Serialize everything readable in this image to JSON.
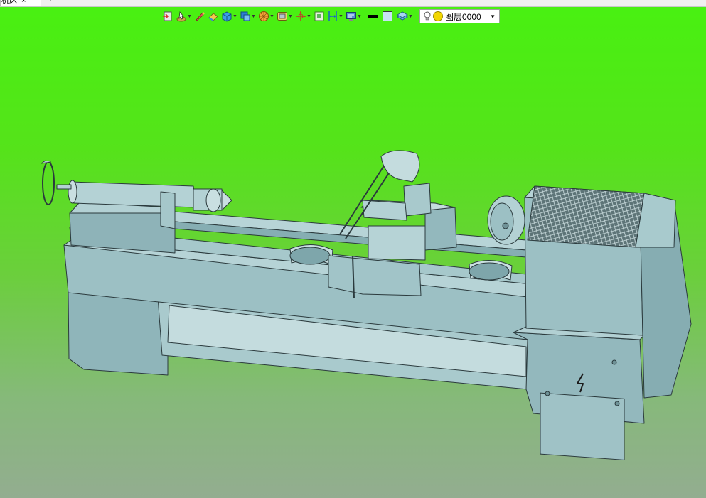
{
  "tab": {
    "title": "机床",
    "close": "×",
    "add": "+"
  },
  "toolbar": {
    "items": [
      {
        "name": "exit-sketch-icon"
      },
      {
        "name": "pointer-tool-icon"
      },
      {
        "name": "pen-tool-icon"
      },
      {
        "name": "eraser-tool-icon"
      },
      {
        "name": "solid-box-icon"
      },
      {
        "name": "view-orientation-icon"
      },
      {
        "name": "render-style-icon"
      },
      {
        "name": "section-view-icon"
      },
      {
        "name": "origin-icon"
      },
      {
        "name": "fit-view-icon"
      },
      {
        "name": "measure-icon"
      },
      {
        "name": "display-settings-icon"
      },
      {
        "name": "line-color-icon"
      },
      {
        "name": "fill-color-icon"
      },
      {
        "name": "layer-stack-icon"
      }
    ],
    "layer": {
      "name": "图层0000",
      "dropdown": "▼"
    }
  },
  "colors": {
    "model": "#9bc0c4",
    "model_dark": "#7fa6ab",
    "edge": "#2b3a3d",
    "bg_top": "#48f111",
    "bg_bottom": "#93ad90"
  }
}
